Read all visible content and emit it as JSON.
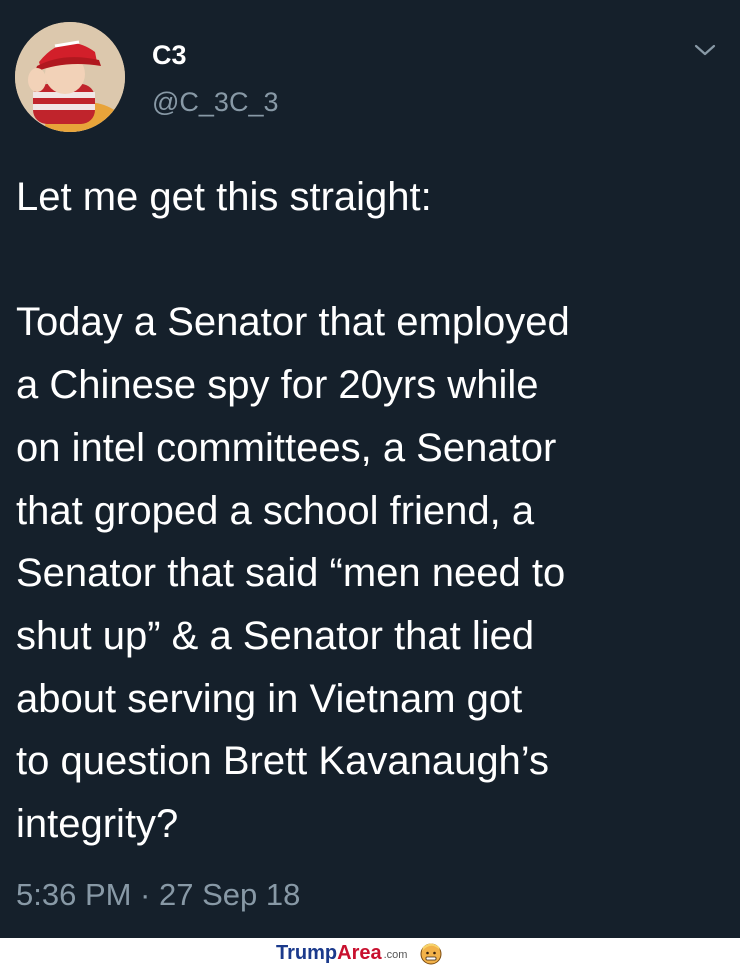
{
  "tweet": {
    "display_name": "C3",
    "handle": "@C_3C_3",
    "avatar_icon": "baby-in-red-cap-avatar",
    "menu_icon": "chevron-down-icon",
    "text": "Let me get this straight:\n\nToday a Senator that employed\na Chinese spy for 20yrs while\non intel committees, a Senator\nthat groped a school friend, a\nSenator that said “men need to\nshut up” & a Senator that lied\nabout serving in Vietnam got\nto question Brett Kavanaugh’s\nintegrity?",
    "timestamp": "5:36 PM · 27 Sep 18"
  },
  "watermark": {
    "part1": "Trump",
    "part2": "Area",
    "suffix": ".com",
    "icon": "trump-face-icon"
  },
  "colors": {
    "background": "#15202b",
    "primary_text": "#ffffff",
    "secondary_text": "#8899a6",
    "watermark_blue": "#1b3a8c",
    "watermark_red": "#c8102e"
  }
}
